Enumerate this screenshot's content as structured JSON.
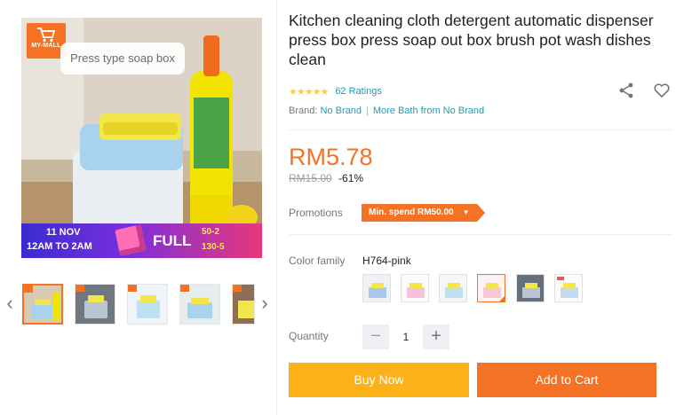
{
  "gallery": {
    "badge_text": "MY-MALL",
    "image_label": "Press type soap box",
    "promo": {
      "date": "11 NOV",
      "time": "12AM TO 2AM",
      "full": "FULL",
      "line1": "50-2",
      "line2": "130-5"
    },
    "thumb_count": 5,
    "active_thumb": 0
  },
  "product": {
    "title": "Kitchen cleaning cloth detergent automatic dispenser press box press soap out box brush pot wash dishes clean",
    "rating_stars": 4.5,
    "ratings_text": "62 Ratings",
    "brand_label": "Brand:",
    "brand_name": "No Brand",
    "more_from": "More Bath from No Brand",
    "price": "RM5.78",
    "original_price": "RM15.00",
    "discount": "-61%",
    "promotions_label": "Promotions",
    "promotion_tag": "Min. spend RM50.00",
    "color_label": "Color family",
    "color_value": "H764-pink",
    "swatch_selected": 3,
    "quantity_label": "Quantity",
    "quantity": "1",
    "minus_label": "−",
    "plus_label": "+",
    "buy_now": "Buy Now",
    "add_to_cart": "Add to Cart"
  },
  "colors": {
    "accent": "#f57224",
    "buy_button": "#fbb117",
    "link": "#1a9cb7",
    "star": "#faca51"
  }
}
